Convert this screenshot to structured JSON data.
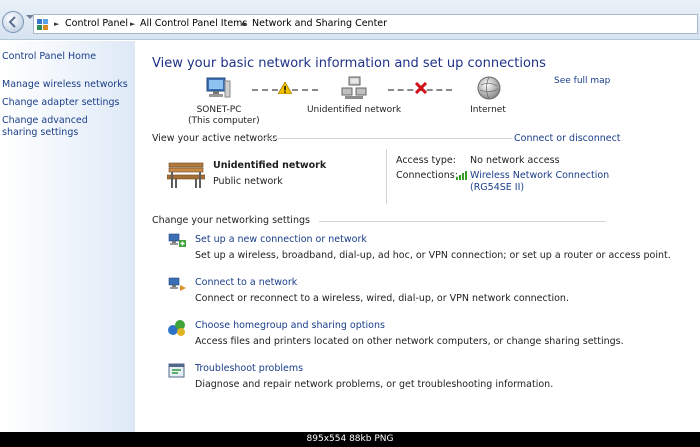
{
  "breadcrumb": {
    "items": [
      "Control Panel",
      "All Control Panel Items",
      "Network and Sharing Center"
    ],
    "separator": "►"
  },
  "sidebar": {
    "items": [
      {
        "label": "Control Panel Home"
      },
      {
        "label": "Manage wireless networks"
      },
      {
        "label": "Change adapter settings"
      },
      {
        "label": "Change advanced sharing settings"
      }
    ]
  },
  "main": {
    "title": "View your basic network information and set up connections",
    "see_full_map": "See full map",
    "map": {
      "computer_name": "SONET-PC",
      "computer_sub": "(This computer)",
      "network_label": "Unidentified network",
      "internet_label": "Internet"
    },
    "active_networks": {
      "header": "View your active networks",
      "connect_link": "Connect or disconnect",
      "network_name": "Unidentified network",
      "network_type": "Public network",
      "access_type_label": "Access type:",
      "access_type_value": "No network access",
      "connections_label": "Connections:",
      "connections_value_line1": "Wireless Network Connection",
      "connections_value_line2": "(RG54SE II)"
    },
    "settings": {
      "header": "Change your networking settings",
      "tasks": [
        {
          "link": "Set up a new connection or network",
          "desc": "Set up a wireless, broadband, dial-up, ad hoc, or VPN connection; or set up a router or access point."
        },
        {
          "link": "Connect to a network",
          "desc": "Connect or reconnect to a wireless, wired, dial-up, or VPN network connection."
        },
        {
          "link": "Choose homegroup and sharing options",
          "desc": "Access files and printers located on other network computers, or change sharing settings."
        },
        {
          "link": "Troubleshoot problems",
          "desc": "Diagnose and repair network problems, or get troubleshooting information."
        }
      ]
    }
  },
  "image_info": "895x554  88kb  PNG",
  "colors": {
    "link": "#1a3e8a",
    "title": "#1e3287",
    "warning": "#f2c200",
    "error": "#d0101a"
  }
}
